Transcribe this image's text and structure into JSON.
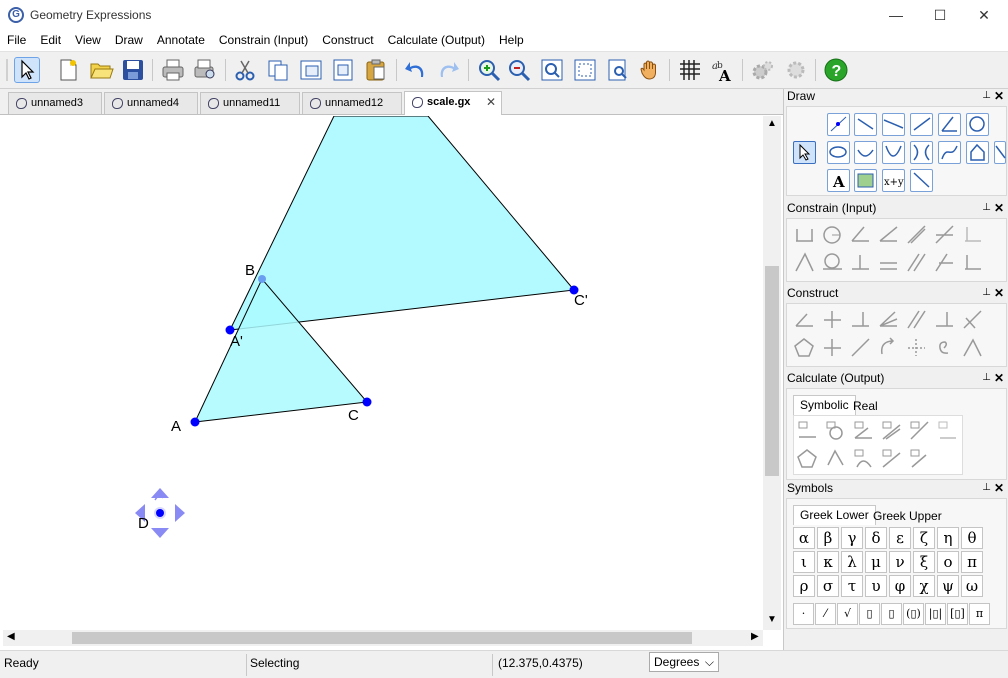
{
  "window": {
    "title": "Geometry Expressions",
    "app_icon_glyph": "G",
    "minimize_glyph": "—",
    "maximize_glyph": "☐",
    "close_glyph": "✕"
  },
  "menu": [
    "File",
    "Edit",
    "View",
    "Draw",
    "Annotate",
    "Constrain (Input)",
    "Construct",
    "Calculate (Output)",
    "Help"
  ],
  "toolbar": {
    "icons": [
      "select-arrow-icon",
      "new-file-icon",
      "open-folder-icon",
      "save-icon",
      "print-icon",
      "print-preview-icon",
      "cut-icon",
      "copy-icon",
      "copy-special-icon",
      "paste-special-icon",
      "paste-icon",
      "undo-icon",
      "redo-icon",
      "zoom-in-icon",
      "zoom-out-icon",
      "zoom-fit-icon",
      "zoom-window-icon",
      "zoom-page-icon",
      "pan-hand-icon",
      "grid-icon",
      "font-icon",
      "gear-icon",
      "gear-disabled-icon",
      "help-icon"
    ]
  },
  "tabs": [
    {
      "label": "unnamed3",
      "active": false
    },
    {
      "label": "unnamed4",
      "active": false
    },
    {
      "label": "unnamed11",
      "active": false
    },
    {
      "label": "unnamed12",
      "active": false
    },
    {
      "label": "scale.gx",
      "active": true,
      "close_glyph": "✕"
    }
  ],
  "canvas": {
    "fill_color": "#aafaff",
    "point_color": "#0000ff",
    "labels": {
      "A": "A",
      "B": "B",
      "C": "C",
      "A_prime": "A'",
      "C_prime": "C'",
      "D": "D"
    }
  },
  "status": {
    "state": "Ready",
    "mode": "Selecting",
    "coords": "(12.375,0.4375)",
    "angle_unit": "Degrees",
    "dropdown_glyph": "⌵"
  },
  "panels": {
    "draw": {
      "title": "Draw"
    },
    "constrain": {
      "title": "Constrain (Input)"
    },
    "construct": {
      "title": "Construct"
    },
    "calculate": {
      "title": "Calculate (Output)",
      "tabs": [
        "Symbolic",
        "Real"
      ],
      "active_tab": "Symbolic"
    },
    "symbols": {
      "title": "Symbols",
      "tabs": [
        "Greek Lower",
        "Greek Upper"
      ],
      "active_tab": "Greek Lower",
      "rows": [
        [
          "α",
          "β",
          "γ",
          "δ",
          "ε",
          "ζ",
          "η",
          "θ"
        ],
        [
          "ι",
          "κ",
          "λ",
          "μ",
          "ν",
          "ξ",
          "ο",
          "π"
        ],
        [
          "ρ",
          "σ",
          "τ",
          "υ",
          "φ",
          "χ",
          "ψ",
          "ω"
        ]
      ],
      "bottom_row": [
        "·",
        "⁄",
        "√",
        "▯",
        "▯",
        "(▯)",
        "|▯|",
        "[▯]",
        "π"
      ]
    },
    "pin_glyph": "⊥",
    "close_glyph": "✕"
  }
}
